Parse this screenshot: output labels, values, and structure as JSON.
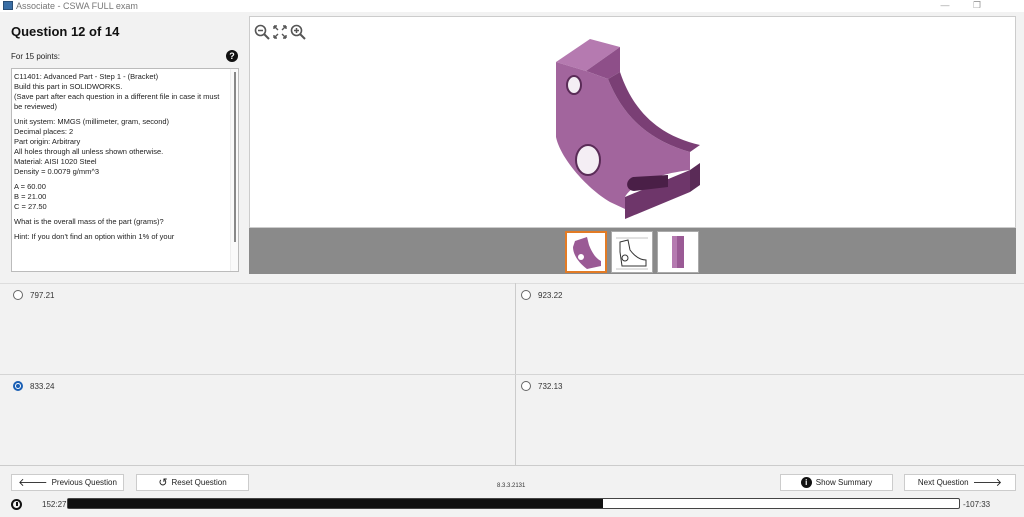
{
  "window": {
    "title": "Associate - CSWA FULL exam",
    "minimize": "—",
    "restore": "❐"
  },
  "question": {
    "title": "Question 12 of 14",
    "points": "For 15 points:",
    "help": "?",
    "lines": [
      "C11401: Advanced Part - Step 1 - (Bracket)",
      "Build this part in SOLIDWORKS.",
      "(Save part after each question in a different file in case it must be reviewed)",
      "",
      "Unit system: MMGS (millimeter, gram, second)",
      "Decimal places: 2",
      "Part origin: Arbitrary",
      "All holes through all unless shown otherwise.",
      "Material: AISI 1020 Steel",
      "Density = 0.0079 g/mm^3",
      "",
      "A = 60.00",
      "B = 21.00",
      "C = 27.50",
      "",
      "What is the overall mass of the part (grams)?",
      "",
      "Hint: If you don't find an option within 1% of your"
    ]
  },
  "viewer": {
    "tools": [
      "zoom-out-icon",
      "fit-icon",
      "zoom-in-icon"
    ],
    "part_color": "#9a5a95",
    "thumbnails": [
      {
        "name": "iso-view",
        "selected": true
      },
      {
        "name": "drawing-view",
        "selected": false
      },
      {
        "name": "side-view",
        "selected": false
      }
    ]
  },
  "answers": [
    {
      "label": "797.21",
      "checked": false
    },
    {
      "label": "923.22",
      "checked": false
    },
    {
      "label": "833.24",
      "checked": true
    },
    {
      "label": "732.13",
      "checked": false
    }
  ],
  "nav": {
    "previous": "Previous Question",
    "reset": "Reset Question",
    "version": "8.3.3.2131",
    "summary": "Show Summary",
    "next": "Next Question"
  },
  "timer": {
    "elapsed": "152:27",
    "remaining": "-107:33",
    "progress_fraction": 0.6
  },
  "colors": {
    "accent": "#1a5fb4",
    "thumb_selected": "#e27b25",
    "part": "#9a5a95"
  }
}
